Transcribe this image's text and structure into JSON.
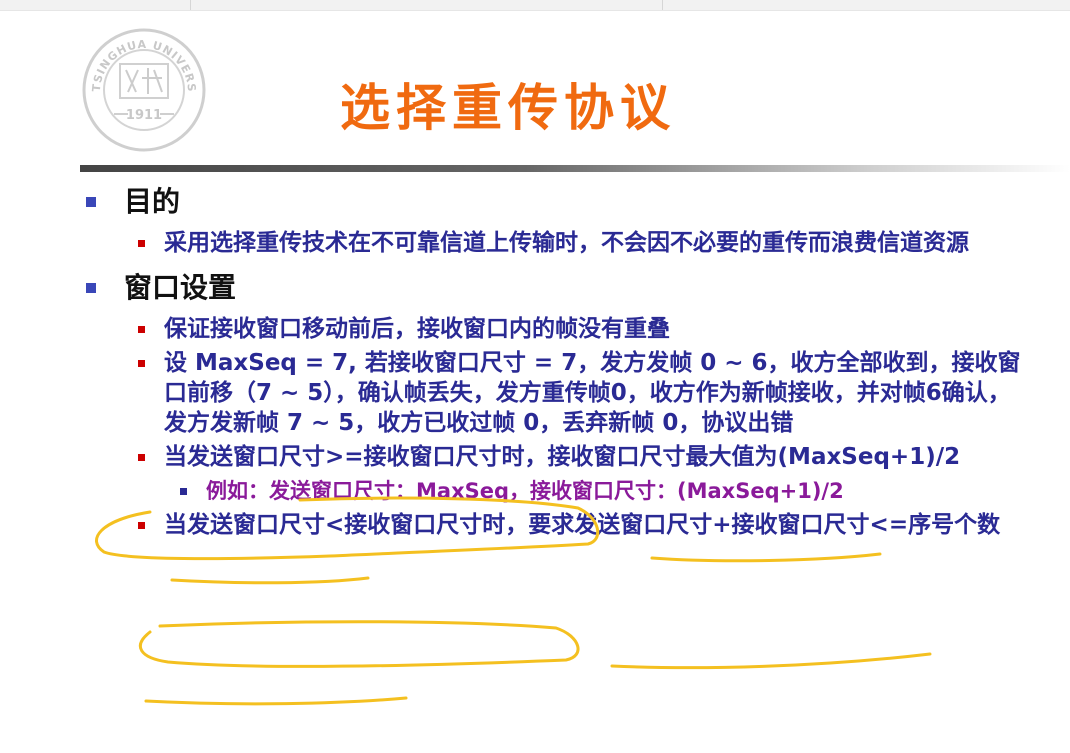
{
  "slide": {
    "title": "选择重传协议",
    "logo": {
      "top_text": "TSINGHUA UNIVERSITY",
      "year": "1911"
    },
    "sections": [
      {
        "heading": "目的",
        "items": [
          {
            "text": "采用选择重传技术在不可靠信道上传输时，不会因不必要的重传而浪费信道资源"
          }
        ]
      },
      {
        "heading": "窗口设置",
        "items": [
          {
            "text": "保证接收窗口移动前后，接收窗口内的帧没有重叠"
          },
          {
            "text": "设 MaxSeq = 7, 若接收窗口尺寸 = 7，发方发帧 0 ~ 6，收方全部收到，接收窗口前移（7 ~ 5），确认帧丢失，发方重传帧0，收方作为新帧接收，并对帧6确认，发方发新帧 7 ~ 5，收方已收过帧 0，丢弃新帧 0，协议出错"
          },
          {
            "text": "当发送窗口尺寸>=接收窗口尺寸时，接收窗口尺寸最大值为(MaxSeq+1)/2",
            "sub": "例如：发送窗口尺寸：MaxSeq，接收窗口尺寸：(MaxSeq+1)/2"
          },
          {
            "text": "当发送窗口尺寸<接收窗口尺寸时，要求发送窗口尺寸+接收窗口尺寸<=序号个数"
          }
        ]
      }
    ]
  },
  "colors": {
    "title": "#f06a10",
    "level1_bullet": "#3a47b8",
    "level2_text": "#2a2a94",
    "level2_bullet": "#cc0000",
    "example_text": "#8a1a9a",
    "highlight": "#f4c020"
  }
}
